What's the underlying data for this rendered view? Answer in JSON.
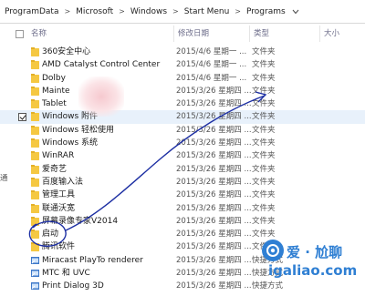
{
  "address": {
    "crumbs": [
      "ProgramData",
      "Microsoft",
      "Windows",
      "Start Menu",
      "Programs"
    ],
    "separator": ">"
  },
  "columns": {
    "name": "名称",
    "date": "修改日期",
    "type": "类型",
    "size": "大小"
  },
  "rows": [
    {
      "name": "360安全中心",
      "date": "2015/4/6 星期一 ...",
      "type": "文件夹",
      "icon": "folder-icon",
      "checked": false
    },
    {
      "name": "AMD Catalyst Control Center",
      "date": "2015/4/6 星期一 ...",
      "type": "文件夹",
      "icon": "folder-icon",
      "checked": false
    },
    {
      "name": "Dolby",
      "date": "2015/4/6 星期一 ...",
      "type": "文件夹",
      "icon": "folder-icon",
      "checked": false
    },
    {
      "name": "Mainte",
      "date": "2015/3/26 星期四 ...",
      "type": "文件夹",
      "icon": "folder-icon",
      "checked": false
    },
    {
      "name": "Tablet",
      "date": "2015/3/26 星期四 ...",
      "type": "文件夹",
      "icon": "folder-icon",
      "checked": false
    },
    {
      "name": "Windows 附件",
      "date": "2015/3/26 星期四 ...",
      "type": "文件夹",
      "icon": "folder-icon",
      "checked": true
    },
    {
      "name": "Windows 轻松使用",
      "date": "2015/3/26 星期四 ...",
      "type": "文件夹",
      "icon": "folder-icon",
      "checked": false
    },
    {
      "name": "Windows 系统",
      "date": "2015/3/26 星期四 ...",
      "type": "文件夹",
      "icon": "folder-icon",
      "checked": false
    },
    {
      "name": "WinRAR",
      "date": "2015/3/26 星期四 ...",
      "type": "文件夹",
      "icon": "folder-icon",
      "checked": false
    },
    {
      "name": "爱奇艺",
      "date": "2015/3/26 星期四 ...",
      "type": "文件夹",
      "icon": "folder-icon",
      "checked": false
    },
    {
      "name": "百度输入法",
      "date": "2015/3/26 星期四 ...",
      "type": "文件夹",
      "icon": "folder-icon",
      "checked": false
    },
    {
      "name": "管理工具",
      "date": "2015/3/26 星期四 ...",
      "type": "文件夹",
      "icon": "folder-icon",
      "checked": false
    },
    {
      "name": "联通沃宽",
      "date": "2015/3/26 星期四 ...",
      "type": "文件夹",
      "icon": "folder-icon",
      "checked": false
    },
    {
      "name": "屏幕录像专家V2014",
      "date": "2015/3/26 星期四 ...",
      "type": "文件夹",
      "icon": "folder-icon",
      "checked": false
    },
    {
      "name": "启动",
      "date": "2015/3/26 星期四 ...",
      "type": "文件夹",
      "icon": "folder-icon",
      "checked": false
    },
    {
      "name": "腾讯软件",
      "date": "2015/3/26 星期四 ...",
      "type": "文件夹",
      "icon": "folder-icon",
      "checked": false
    },
    {
      "name": "Miracast PlayTo renderer",
      "date": "2015/3/26 星期四 ...",
      "type": "快捷方式",
      "icon": "shortcut-app-icon",
      "checked": false
    },
    {
      "name": "MTC 和 UVC",
      "date": "2015/3/26 星期四 ...",
      "type": "快捷方式",
      "icon": "shortcut-app-icon",
      "checked": false
    },
    {
      "name": "Print Dialog 3D",
      "date": "2015/3/26 星期四 ...",
      "type": "快捷方式",
      "icon": "shortcut-app-icon",
      "checked": false
    }
  ],
  "left_edge_char": "通",
  "watermark": {
    "line1": "爱 · 尬聊",
    "line2": "igaliao.com"
  },
  "colors": {
    "folder": "#f5c842",
    "annotation_ink": "#1d2fa3",
    "watermark": "#2f7fd3",
    "selection": "#e8f1fb"
  }
}
